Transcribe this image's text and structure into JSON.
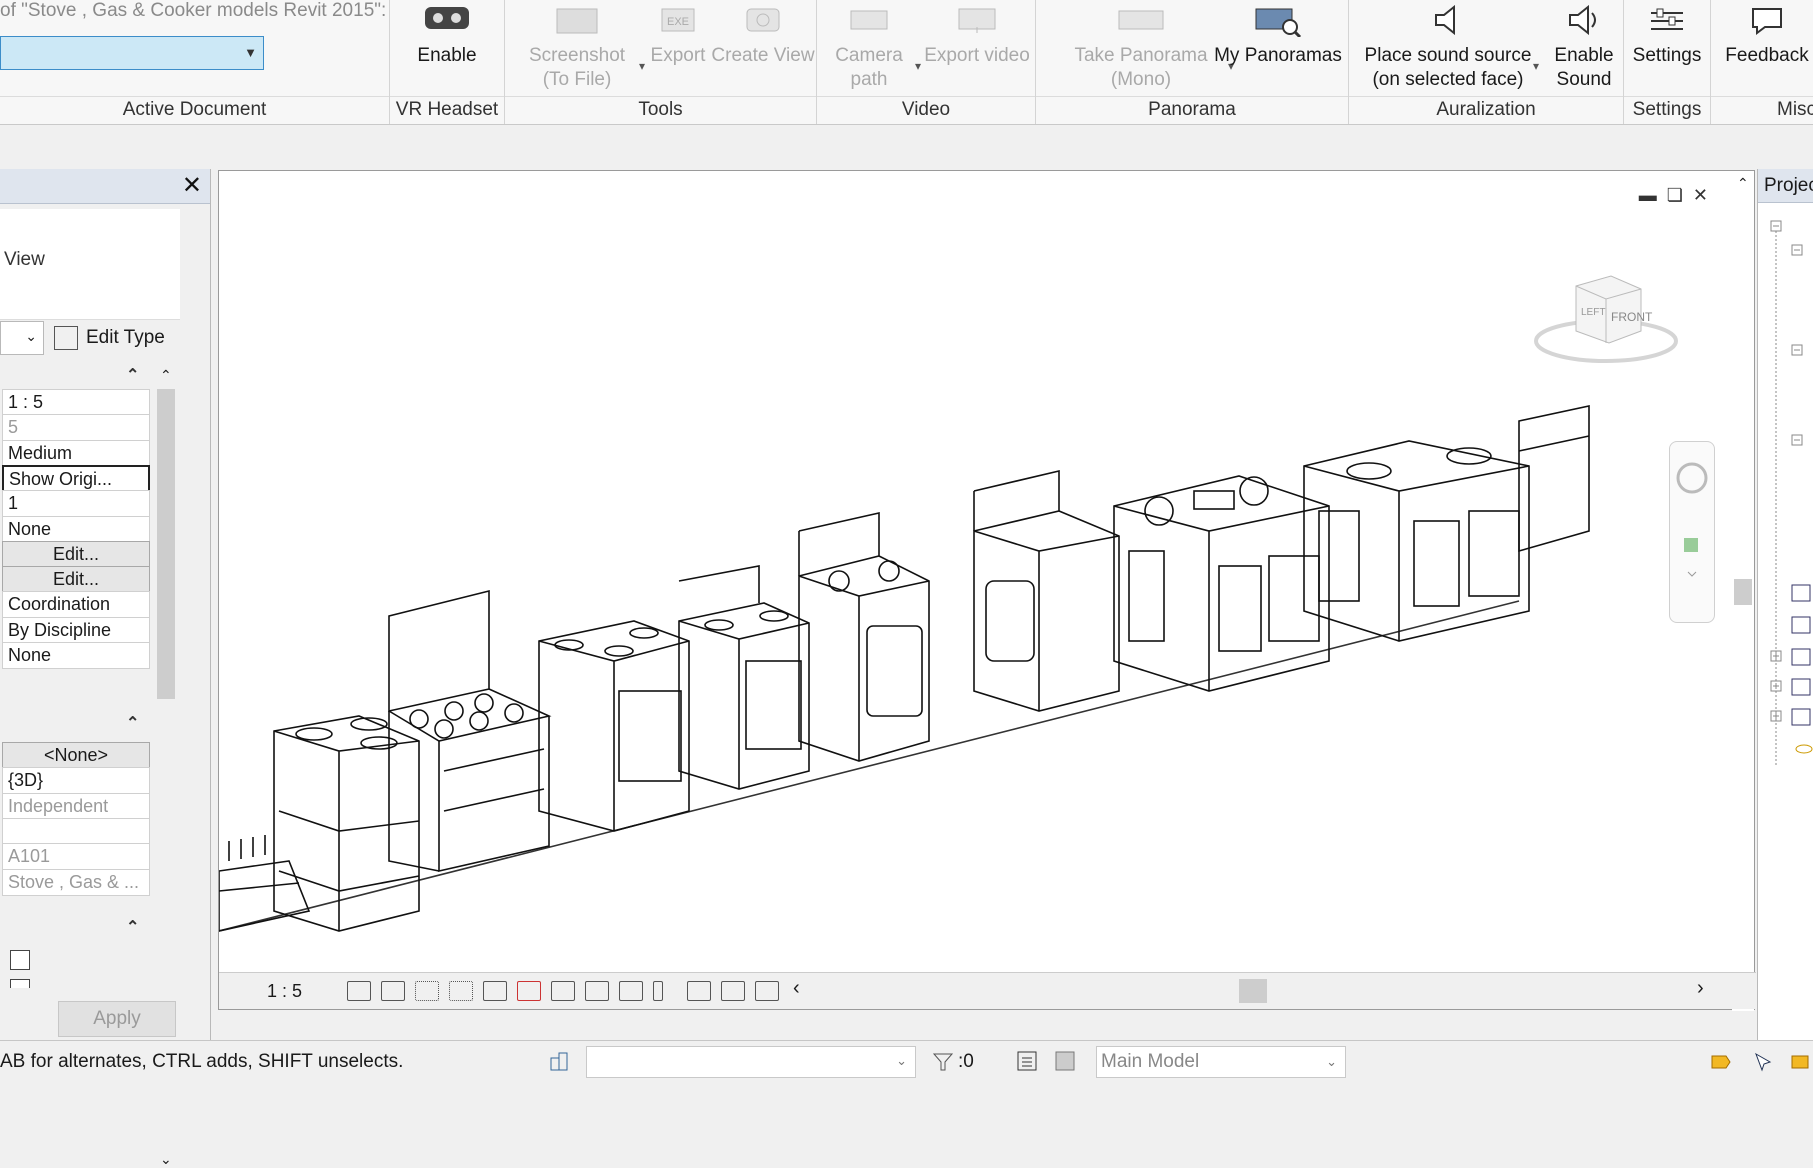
{
  "active_document": {
    "caption": "of \"Stove , Gas & Cooker models Revit 2015\":",
    "selector_value": "",
    "panel_title": "Active Document"
  },
  "ribbon": {
    "panels": [
      {
        "title": "VR Headset"
      },
      {
        "title": "Tools"
      },
      {
        "title": "Video"
      },
      {
        "title": "Panorama"
      },
      {
        "title": "Auralization"
      },
      {
        "title": "Settings"
      },
      {
        "title": "Misc"
      }
    ],
    "buttons": {
      "enable": {
        "line1": "Enable",
        "line2": ""
      },
      "screenshot": {
        "line1": "Screenshot",
        "line2": "(To File)"
      },
      "export": {
        "line1": "Export",
        "line2": ""
      },
      "create_view": {
        "line1": "Create View",
        "line2": ""
      },
      "camera_path": {
        "line1": "Camera",
        "line2": "path"
      },
      "export_video": {
        "line1": "Export video",
        "line2": ""
      },
      "take_panorama": {
        "line1": "Take Panorama",
        "line2": "(Mono)"
      },
      "my_panoramas": {
        "line1": "My Panoramas",
        "line2": ""
      },
      "place_sound": {
        "line1": "Place sound source",
        "line2": "(on selected face)"
      },
      "enable_sound": {
        "line1": "Enable",
        "line2": "Sound"
      },
      "settings": {
        "line1": "Settings",
        "line2": ""
      },
      "feedback": {
        "line1": "Feedback",
        "line2": ""
      }
    }
  },
  "properties": {
    "type_label": "View",
    "edit_type": "Edit Type",
    "rows_group1": [
      {
        "value": "1 : 5",
        "style": "normal"
      },
      {
        "value": "5",
        "style": "grey"
      },
      {
        "value": "Medium",
        "style": "normal"
      },
      {
        "value": "Show Origi...",
        "style": "focus"
      },
      {
        "value": "1",
        "style": "normal"
      },
      {
        "value": "None",
        "style": "normal"
      },
      {
        "value": "Edit...",
        "style": "btn"
      },
      {
        "value": "Edit...",
        "style": "btn"
      },
      {
        "value": "Coordination",
        "style": "normal"
      },
      {
        "value": "By Discipline",
        "style": "normal"
      },
      {
        "value": "None",
        "style": "normal"
      }
    ],
    "rows_group2": [
      {
        "value": "<None>",
        "style": "btn"
      },
      {
        "value": "{3D}",
        "style": "normal"
      },
      {
        "value": "Independent",
        "style": "grey"
      },
      {
        "value": "",
        "style": "normal"
      },
      {
        "value": "A101",
        "style": "grey"
      },
      {
        "value": "Stove , Gas & ...",
        "style": "grey"
      }
    ],
    "apply": "Apply"
  },
  "viewport": {
    "scale": "1 : 5",
    "viewcube_face": "FRONT",
    "viewcube_side": "LEFT"
  },
  "browser": {
    "title": "Project Browser"
  },
  "statusbar": {
    "hint": "AB for alternates, CTRL adds, SHIFT unselects.",
    "selection_count": ":0",
    "model": "Main Model"
  }
}
